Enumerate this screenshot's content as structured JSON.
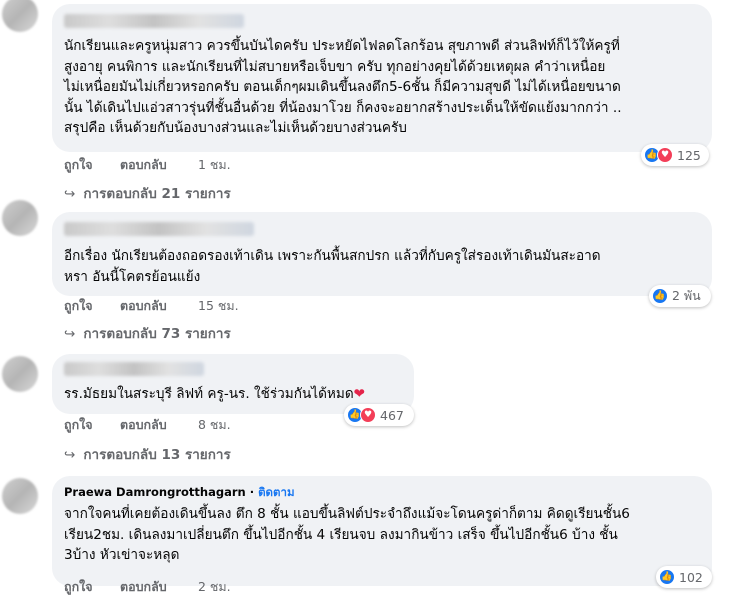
{
  "actions": {
    "like": "ถูกใจ",
    "reply": "ตอบกลับ"
  },
  "comments": [
    {
      "text": "นักเรียนและครูหนุ่มสาว ควรขึ้นบันไดครับ ประหยัดไฟลดโลกร้อน สุขภาพดี ส่วนลิฟท์ก็ไว้ให้ครูที่\nสูงอายุ คนพิการ และนักเรียนที่ไม่สบายหรือเจ็บขา ครับ ทุกอย่างคุยได้ด้วยเหตุผล คำว่าเหนื่อย\nไม่เหนื่อยมันไม่เกี่ยวหรอกครับ ตอนเด็กๆผมเดินขึ้นลงตึก5-6ชั้น ก็มีความสุขดี ไม่ได้เหนื่อยขนาด\nนั้น ได้เดินไปแอ่วสาวรุ่นที่ชั้นอื่นด้วย ที่น้องมาโวย ก็คงจะอยากสร้างประเด็นให้ขัดแย้งมากกว่า ..\nสรุปคือ เห็นด้วยกับน้องบางส่วนและไม่เห็นด้วยบางส่วนครับ",
      "time": "1 ชม.",
      "reactions": "125",
      "replies": "การตอบกลับ 21 รายการ"
    },
    {
      "text": "อีกเรื่อง นักเรียนต้องถอดรองเท้าเดิน เพราะกันพื้นสกปรก แล้วที่กับครูใส่รองเท้าเดินมันสะอาด\nหรา อันนี้โคตรย้อนแย้ง",
      "time": "15 ชม.",
      "reactions": "2 พัน",
      "replies": "การตอบกลับ 73 รายการ"
    },
    {
      "text": "รร.มัธยมในสระบุรี ลิฟท์ ครู-นร. ใช้ร่วมกันได้หมด",
      "text_emoji": "❤️",
      "time": "8 ชม.",
      "reactions": "467",
      "replies": "การตอบกลับ 13 รายการ"
    },
    {
      "author": "Praewa Damrongrotthagarn",
      "follow": "ติดตาม",
      "text": "จากใจคนที่เคยต้องเดินขึ้นลง ตึก 8 ชั้น แอบขึ้นลิฟต์ประจำถึงแม้จะโดนครูด่าก็ตาม คิดดูเรียนชั้น6\nเรียน2ชม. เดินลงมาเปลี่ยนตึก ขึ้นไปอีกชั้น 4 เรียนจบ ลงมากินข้าว เสร็จ ขึ้นไปอีกชั้น6 บ้าง ชั้น\n3บ้าง หัวเข่าจะหลุด",
      "time": "2 ชม.",
      "reactions": "102"
    }
  ],
  "icons": {
    "like": "like-icon",
    "love": "love-icon",
    "reply_arrow": "reply-arrow-icon"
  },
  "colors": {
    "accent": "#1877f2",
    "bubble": "#f0f2f5",
    "meta": "#65676b",
    "love": "#f33e58"
  }
}
